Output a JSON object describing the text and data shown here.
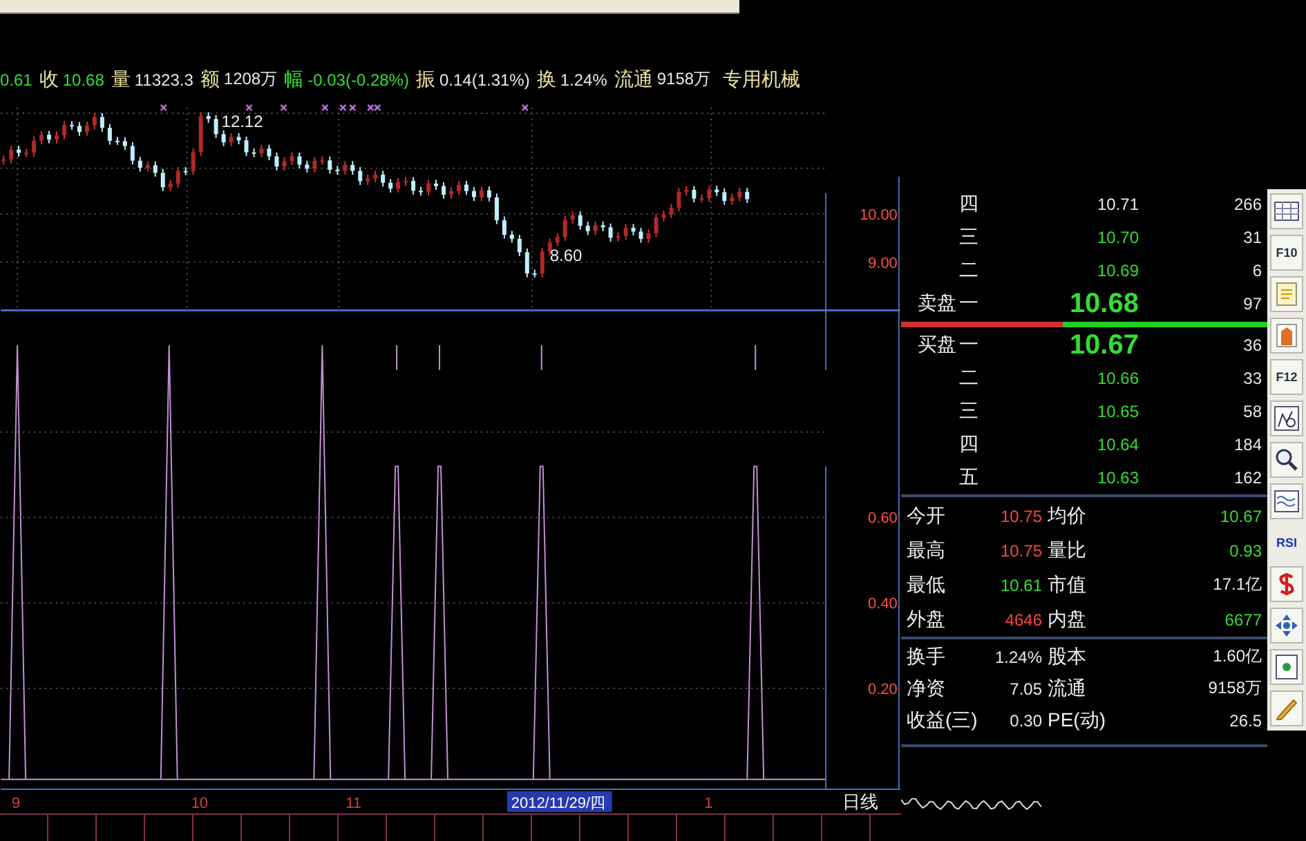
{
  "quote_line": [
    {
      "value": "0.61",
      "color": "#33dd33"
    },
    {
      "label": "收",
      "value": "10.68",
      "color": "#33dd33"
    },
    {
      "label": "量",
      "value": "11323.3",
      "color": "#e8e8e8"
    },
    {
      "label": "额",
      "value": "1208万",
      "color": "#e8e8e8"
    },
    {
      "label": "幅",
      "value": "-0.03(-0.28%)",
      "color": "#33dd33"
    },
    {
      "label": "振",
      "value": "0.14(1.31%)",
      "color": "#e8e8e8"
    },
    {
      "label": "换",
      "value": "1.24%",
      "color": "#e8e8e8"
    },
    {
      "label": "流通",
      "value": "9158万",
      "color": "#e8e8e8"
    }
  ],
  "industry": "专用机械",
  "price_chart": {
    "high_label": "12.12",
    "low_label": "8.60",
    "axis_labels": [
      "10.00",
      "9.00"
    ]
  },
  "indicator_chart": {
    "axis_labels": [
      "0.60",
      "0.40",
      "0.20"
    ]
  },
  "date_axis": [
    {
      "label": "9",
      "selected": false
    },
    {
      "label": "10",
      "selected": false
    },
    {
      "label": "11",
      "selected": false
    },
    {
      "label": "2012/11/29/四",
      "selected": true
    },
    {
      "label": "1",
      "selected": false
    }
  ],
  "period": "日线",
  "order_book": {
    "sell_label": "卖盘",
    "buy_label": "买盘",
    "sell": [
      {
        "level": "四",
        "price": "10.71",
        "volume": "266",
        "color": "#e8e8e8"
      },
      {
        "level": "三",
        "price": "10.70",
        "volume": "31",
        "color": "#33dd33"
      },
      {
        "level": "二",
        "price": "10.69",
        "volume": "6",
        "color": "#33dd33"
      },
      {
        "level": "一",
        "price": "10.68",
        "volume": "97",
        "color": "#33dd33"
      }
    ],
    "ratio": {
      "level": 0.44
    },
    "buy": [
      {
        "level": "一",
        "price": "10.67",
        "volume": "36",
        "color": "#33dd33"
      },
      {
        "level": "二",
        "price": "10.66",
        "volume": "33",
        "color": "#33dd33"
      },
      {
        "level": "三",
        "price": "10.65",
        "volume": "58",
        "color": "#33dd33"
      },
      {
        "level": "四",
        "price": "10.64",
        "volume": "184",
        "color": "#33dd33"
      },
      {
        "level": "五",
        "price": "10.63",
        "volume": "162",
        "color": "#33dd33"
      }
    ]
  },
  "stats": [
    [
      {
        "label": "今开",
        "value": "10.75",
        "color": "#ff4444"
      },
      {
        "label": "均价",
        "value": "10.67",
        "color": "#33dd33"
      }
    ],
    [
      {
        "label": "最高",
        "value": "10.75",
        "color": "#ff4444"
      },
      {
        "label": "量比",
        "value": "0.93",
        "color": "#33dd33"
      }
    ],
    [
      {
        "label": "最低",
        "value": "10.61",
        "color": "#33dd33"
      },
      {
        "label": "市值",
        "value": "17.1亿",
        "color": "#e8e8e8"
      }
    ],
    [
      {
        "label": "外盘",
        "value": "4646",
        "color": "#ff4444"
      },
      {
        "label": "内盘",
        "value": "6677",
        "color": "#33dd33"
      }
    ]
  ],
  "finance": [
    [
      {
        "label": "换手",
        "value": "1.24%"
      },
      {
        "label": "股本",
        "value": "1.60亿"
      }
    ],
    [
      {
        "label": "净资",
        "value": "7.05"
      },
      {
        "label": "流通",
        "value": "9158万"
      }
    ],
    [
      {
        "label": "收益(三)",
        "value": "0.30"
      },
      {
        "label": "PE(动)",
        "value": "26.5"
      }
    ]
  ],
  "toolbar": [
    {
      "kind": "icon"
    },
    {
      "kind": "text",
      "label": "F10"
    },
    {
      "kind": "icon"
    },
    {
      "kind": "icon"
    },
    {
      "kind": "text",
      "label": "F12"
    },
    {
      "kind": "icon"
    },
    {
      "kind": "icon"
    },
    {
      "kind": "icon"
    },
    {
      "kind": "text",
      "label": "RSI"
    },
    {
      "kind": "icon"
    },
    {
      "kind": "icon"
    },
    {
      "kind": "icon"
    },
    {
      "kind": "icon"
    }
  ]
}
